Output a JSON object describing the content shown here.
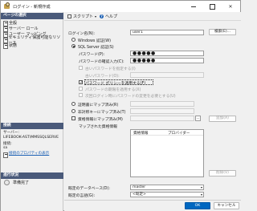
{
  "window": {
    "title": "ログイン - 新規作成"
  },
  "left": {
    "select_page_header": "ページの選択",
    "pages": [
      {
        "label": "全般",
        "icon": "page-icon"
      },
      {
        "label": "サーバー ロール",
        "icon": "page-icon"
      },
      {
        "label": "ユーザー マッピング",
        "icon": "page-icon"
      },
      {
        "label": "セキュリティ保護可能なリソース",
        "icon": "page-icon"
      },
      {
        "label": "状態",
        "icon": "page-icon"
      }
    ],
    "connection_header": "接続",
    "server_label": "サーバー:",
    "server_value": "LIFEBOOK-AST\\MMSSQLSERVE",
    "connect_label": "接続:",
    "connect_value": "sa",
    "view_properties_link": "接続のプロパティの表示",
    "progress_header": "進行状況",
    "progress_status": "準備完了"
  },
  "toolbar": {
    "script_label": "スクリプト",
    "script_icon": "script-icon",
    "help_label": "ヘルプ",
    "help_icon": "help-icon"
  },
  "form": {
    "login_name_label": "ログイン名(N):",
    "login_name_value": "user1",
    "search_button": "検索(E)...",
    "windows_auth_label": "Windows 認証(W)",
    "sql_auth_label": "SQL Server 認証(S)",
    "password_label": "パスワード(P):",
    "password_value": "●●●●●",
    "confirm_password_label": "パスワードの確認入力(C):",
    "confirm_password_value": "●●●●●",
    "specify_old_password_label": "古いパスワードを指定する(I)",
    "old_password_label": "古いパスワード(O):",
    "enforce_policy_label": "パスワード ポリシーを適用する(F)",
    "enforce_expiration_label": "パスワードの期限を適用する(X)",
    "must_change_label": "次回ログイン時にパスワードの変更を必要とする(U)",
    "cert_map_label": "証明書にマップ済み(R)",
    "asym_key_map_label": "非対称キーにマップ済み(T)",
    "credential_map_label": "資格情報にマップ済み(M)",
    "add_button": "追加(A)",
    "mapped_credentials_label": "マップされた資格情報",
    "credential_column": "資格情報",
    "provider_column": "プロバイダー",
    "remove_button": "削除(V)",
    "default_db_label": "既定のデータベース(D):",
    "default_db_value": "master",
    "default_lang_label": "既定の言語(G):",
    "default_lang_value": "<既定>"
  },
  "footer": {
    "ok_button": "OK",
    "cancel_button": "キャンセル"
  },
  "colors": {
    "section_header": "#4a5a7a",
    "ok_button": "#0067c0",
    "link": "#1a5fb4"
  }
}
